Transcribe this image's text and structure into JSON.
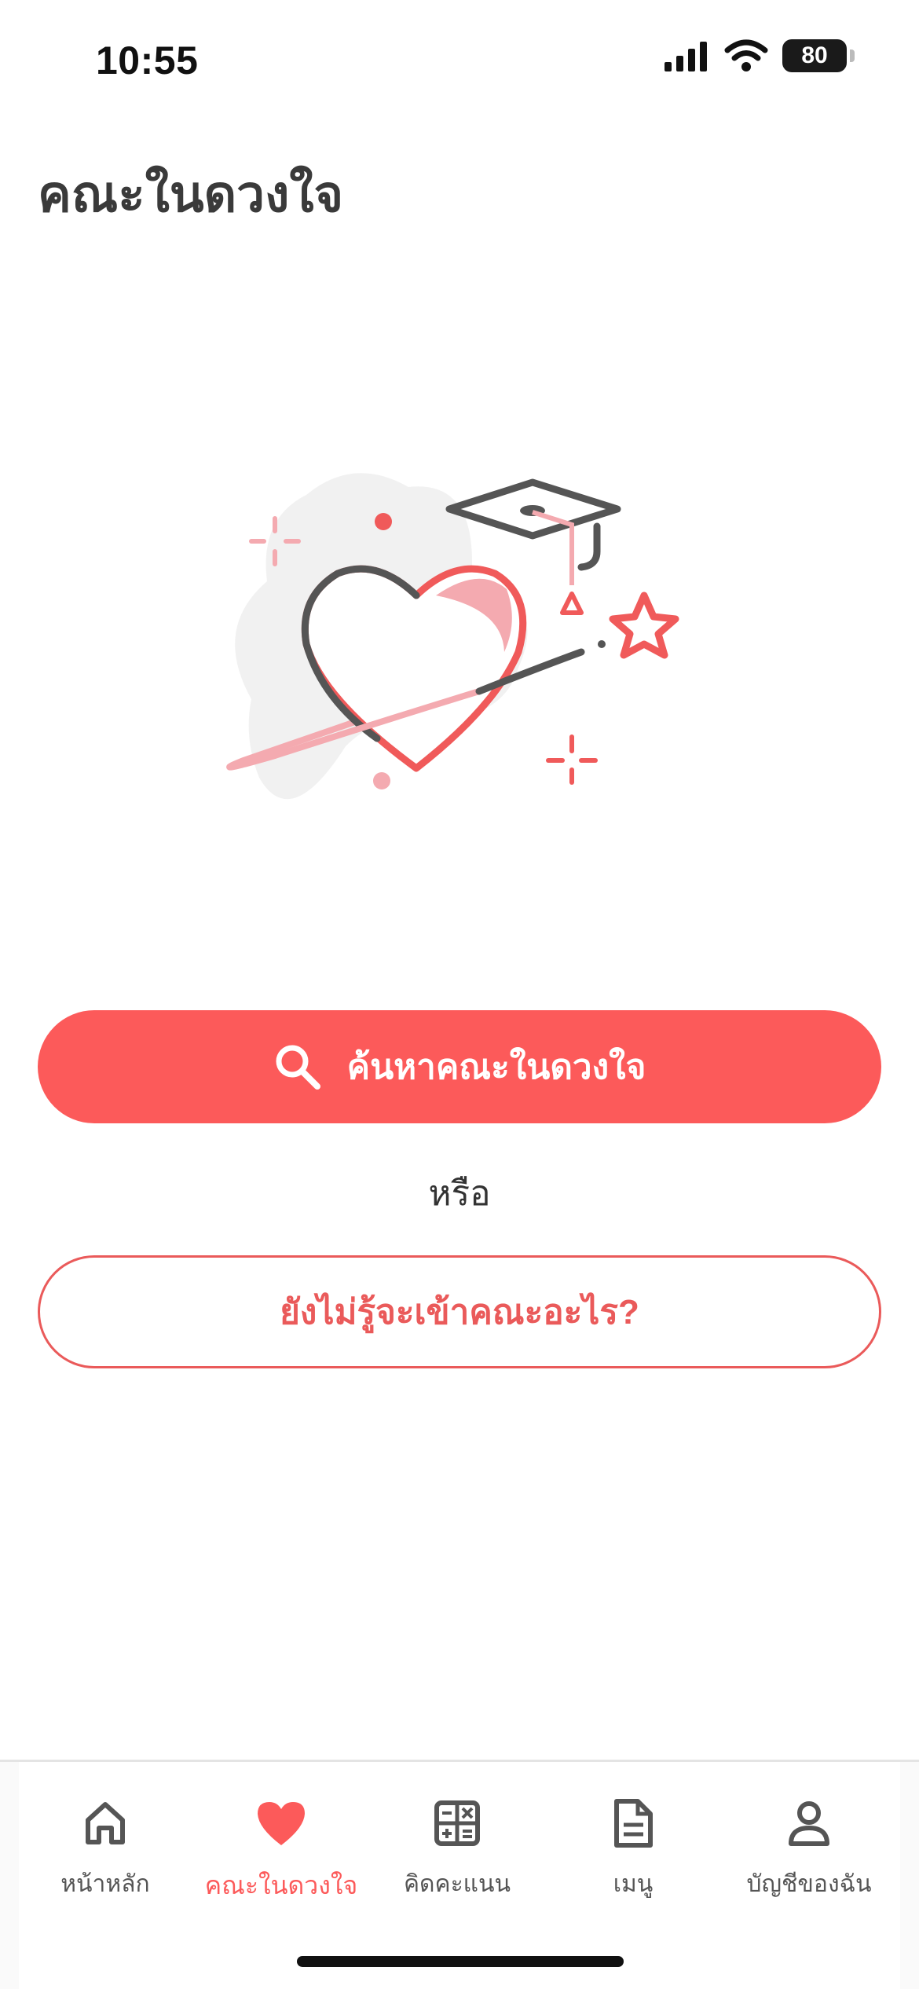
{
  "status_bar": {
    "time": "10:55",
    "battery": "80"
  },
  "header": {
    "title": "คณะในดวงใจ"
  },
  "main": {
    "search_button_label": "ค้นหาคณะในดวงใจ",
    "or_text": "หรือ",
    "undecided_button_label": "ยังไม่รู้จะเข้าคณะอะไร?"
  },
  "nav": {
    "items": [
      {
        "label": "หน้าหลัก",
        "icon": "home-icon"
      },
      {
        "label": "คณะในดวงใจ",
        "icon": "heart-icon",
        "active": true
      },
      {
        "label": "คิดคะแนน",
        "icon": "calculator-icon"
      },
      {
        "label": "เมนู",
        "icon": "document-icon"
      },
      {
        "label": "บัญชีของฉัน",
        "icon": "user-icon"
      }
    ]
  },
  "colors": {
    "accent": "#fc5a5a",
    "accent_outline": "#ea5a5a",
    "pink": "#f4aab0",
    "dark": "#555555"
  }
}
